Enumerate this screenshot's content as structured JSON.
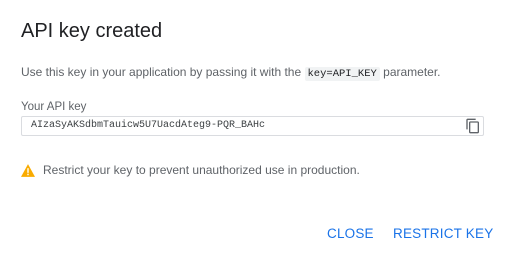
{
  "dialog": {
    "title": "API key created",
    "description_prefix": "Use this key in your application by passing it with the",
    "description_code": "key=API_KEY",
    "description_suffix": "parameter.",
    "field_label": "Your API key",
    "api_key": "AIzaSyAKSdbmTauicw5U7UacdAteg9-PQR_BAHc",
    "copy_icon": "copy-icon",
    "warning_icon": "warning-icon",
    "warning_text": "Restrict your key to prevent unauthorized use in production.",
    "close_label": "CLOSE",
    "restrict_label": "RESTRICT KEY"
  },
  "colors": {
    "accent": "#1a73e8",
    "warning": "#f9ab00",
    "text_primary": "#202124",
    "text_secondary": "#5f6368",
    "border": "#dadce0"
  }
}
